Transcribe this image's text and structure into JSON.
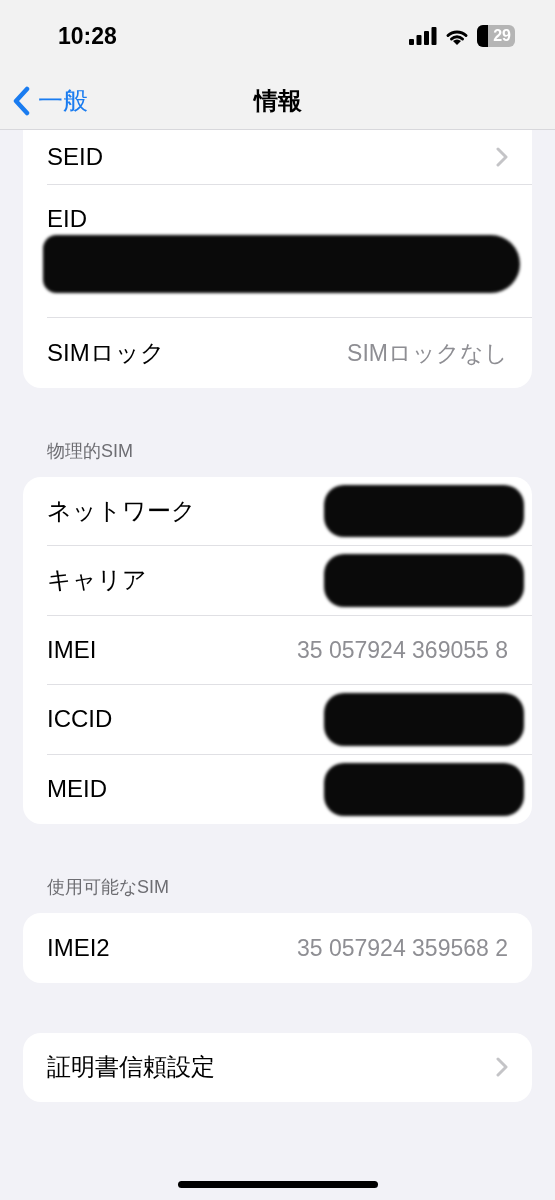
{
  "status_bar": {
    "time": "10:28",
    "battery": "29"
  },
  "nav": {
    "back": "一般",
    "title": "情報"
  },
  "sections": [
    {
      "cut_top": true,
      "rows": [
        {
          "kind": "chevron",
          "label": "SEID"
        },
        {
          "kind": "stacked",
          "label": "EID",
          "redacted": true
        },
        {
          "kind": "value",
          "label": "SIMロック",
          "value": "SIMロックなし"
        }
      ]
    },
    {
      "header": "物理的SIM",
      "rows": [
        {
          "kind": "value",
          "label": "ネットワーク",
          "redacted": true
        },
        {
          "kind": "value",
          "label": "キャリア",
          "redacted": true
        },
        {
          "kind": "value",
          "label": "IMEI",
          "value": "35 057924 369055 8"
        },
        {
          "kind": "value",
          "label": "ICCID",
          "redacted": true
        },
        {
          "kind": "value",
          "label": "MEID",
          "redacted": true
        }
      ]
    },
    {
      "header": "使用可能なSIM",
      "rows": [
        {
          "kind": "value",
          "label": "IMEI2",
          "value": "35 057924 359568 2"
        }
      ]
    },
    {
      "rows": [
        {
          "kind": "chevron",
          "label": "証明書信頼設定"
        }
      ]
    }
  ]
}
